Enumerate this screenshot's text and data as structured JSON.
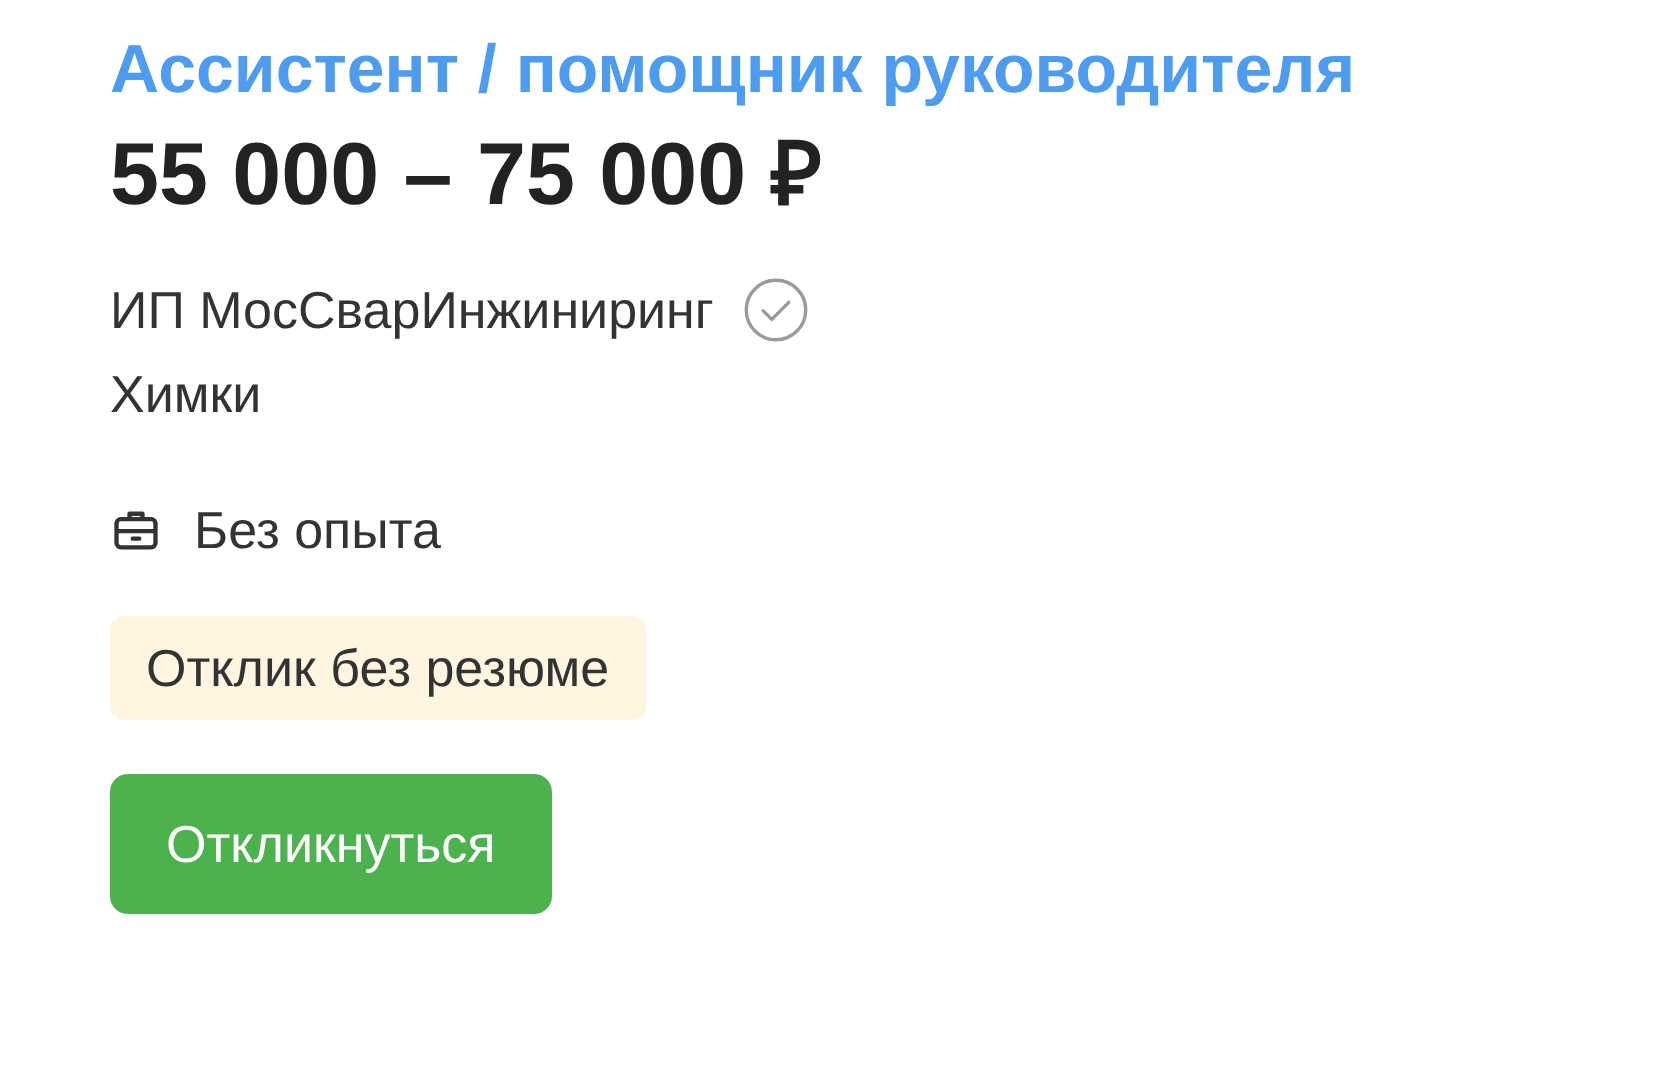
{
  "vacancy": {
    "title": "Ассистент / помощник руководителя",
    "salary": "55 000 – 75 000 ₽",
    "company": "ИП МосСварИнжиниринг",
    "city": "Химки",
    "experience": "Без опыта",
    "badge": "Отклик без резюме",
    "button": "Откликнуться"
  }
}
